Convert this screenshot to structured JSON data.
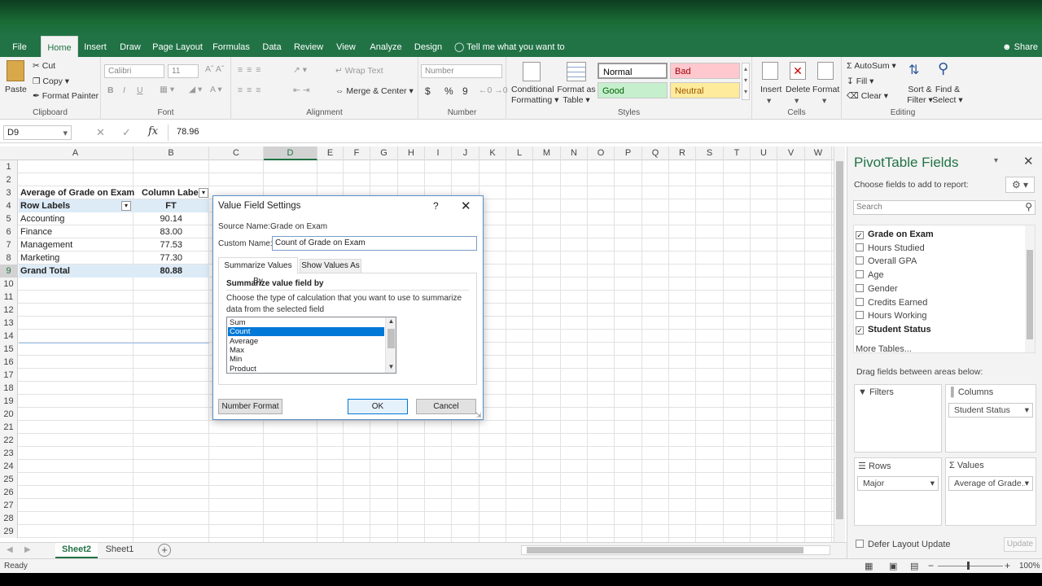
{
  "menu": {
    "tabs": [
      "File",
      "Home",
      "Insert",
      "Draw",
      "Page Layout",
      "Formulas",
      "Data",
      "Review",
      "View",
      "Analyze",
      "Design"
    ],
    "tell_me": "Tell me what you want to do",
    "share": "Share"
  },
  "ribbon": {
    "clipboard": {
      "paste": "Paste",
      "cut": "Cut",
      "copy": "Copy",
      "format_painter": "Format Painter",
      "label": "Clipboard"
    },
    "font": {
      "name": "Calibri",
      "size": "11",
      "bold": "B",
      "italic": "I",
      "underline": "U",
      "label": "Font"
    },
    "alignment": {
      "wrap": "Wrap Text",
      "merge": "Merge & Center",
      "label": "Alignment"
    },
    "number": {
      "format": "Number",
      "currency": "$",
      "percent": "%",
      "comma": "9",
      "label": "Number"
    },
    "styles": {
      "cond_1": "Conditional",
      "cond_2": "Formatting",
      "table_1": "Format as",
      "table_2": "Table",
      "normal": "Normal",
      "bad": "Bad",
      "good": "Good",
      "neutral": "Neutral",
      "label": "Styles"
    },
    "cells": {
      "insert": "Insert",
      "delete": "Delete",
      "format": "Format",
      "label": "Cells"
    },
    "editing": {
      "autosum": "AutoSum",
      "fill": "Fill",
      "clear": "Clear",
      "sort_1": "Sort &",
      "sort_2": "Filter",
      "find_1": "Find &",
      "find_2": "Select",
      "label": "Editing"
    }
  },
  "formula_bar": {
    "name_box": "D9",
    "value": "78.96"
  },
  "columns": [
    "A",
    "B",
    "C",
    "D",
    "E",
    "F",
    "G",
    "H",
    "I",
    "J",
    "K",
    "L",
    "M",
    "N",
    "O",
    "P",
    "Q",
    "R",
    "S",
    "T",
    "U",
    "V",
    "W"
  ],
  "rows": [
    "1",
    "2",
    "3",
    "4",
    "5",
    "6",
    "7",
    "8",
    "9",
    "10",
    "11",
    "12",
    "13",
    "14",
    "15",
    "16",
    "17",
    "18",
    "19",
    "20",
    "21",
    "22",
    "23",
    "24",
    "25",
    "26",
    "27",
    "28",
    "29"
  ],
  "pivot": {
    "header": "Average of Grade on Exam",
    "column_labels": "Column Labels",
    "row_labels": "Row Labels",
    "ft": "FT",
    "rows": [
      {
        "label": "Accounting",
        "value": "90.14"
      },
      {
        "label": "Finance",
        "value": "83.00"
      },
      {
        "label": "Management",
        "value": "77.53"
      },
      {
        "label": "Marketing",
        "value": "77.30"
      }
    ],
    "grand_total_label": "Grand Total",
    "grand_total_value": "80.88"
  },
  "dialog": {
    "title": "Value Field Settings",
    "help": "?",
    "source_label": "Source Name:",
    "source_value": "Grade on Exam",
    "custom_label": "Custom Name:",
    "custom_value": "Count of Grade on Exam",
    "tab_summarize": "Summarize Values By",
    "tab_show": "Show Values As",
    "section_title": "Summarize value field by",
    "desc1": "Choose the type of calculation that you want to use to summarize",
    "desc2": "data from the selected field",
    "options": [
      "Sum",
      "Count",
      "Average",
      "Max",
      "Min",
      "Product"
    ],
    "selected": "Count",
    "number_format": "Number Format",
    "ok": "OK",
    "cancel": "Cancel"
  },
  "pane": {
    "title": "PivotTable Fields",
    "choose": "Choose fields to add to report:",
    "search_placeholder": "Search",
    "fields": [
      {
        "label": "Grade on Exam",
        "checked": true
      },
      {
        "label": "Hours Studied",
        "checked": false
      },
      {
        "label": "Overall GPA",
        "checked": false
      },
      {
        "label": "Age",
        "checked": false
      },
      {
        "label": "Gender",
        "checked": false
      },
      {
        "label": "Credits Earned",
        "checked": false
      },
      {
        "label": "Hours Working",
        "checked": false
      },
      {
        "label": "Student Status",
        "checked": true
      }
    ],
    "more_tables": "More Tables...",
    "drag_label": "Drag fields between areas below:",
    "filters": "Filters",
    "columns": "Columns",
    "columns_item": "Student Status",
    "rows": "Rows",
    "rows_item": "Major",
    "values": "Values",
    "values_item": "Average of Grade...",
    "defer": "Defer Layout Update",
    "update": "Update"
  },
  "sheets": {
    "active": "Sheet2",
    "other": "Sheet1"
  },
  "status": {
    "ready": "Ready",
    "zoom": "100%"
  }
}
